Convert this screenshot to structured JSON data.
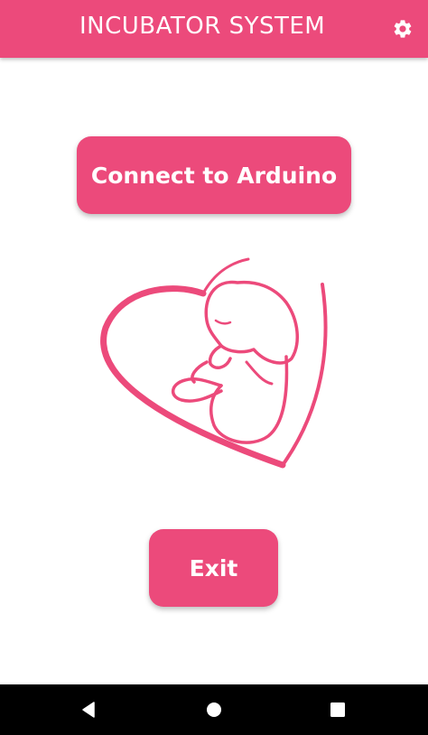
{
  "app_bar": {
    "title": "INCUBATOR SYSTEM",
    "settings_icon": "gear-icon",
    "background_color": "#ec4a7b"
  },
  "main": {
    "connect_button_label": "Connect to Arduino",
    "logo_icon": "baby-heart-logo",
    "exit_button_label": "Exit",
    "accent_color": "#ec4a7b"
  },
  "system_nav": {
    "back_icon": "back-triangle-icon",
    "home_icon": "home-circle-icon",
    "recents_icon": "recents-square-icon"
  }
}
